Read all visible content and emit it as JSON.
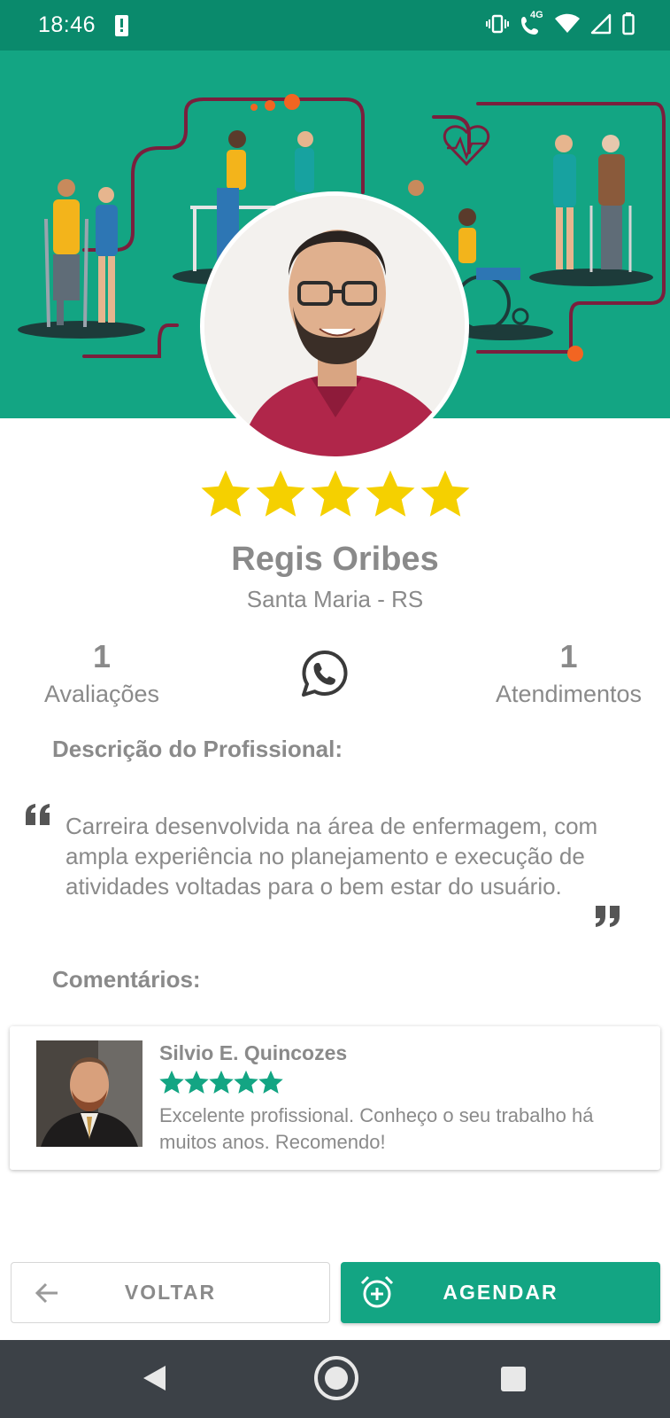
{
  "status_bar": {
    "time": "18:46",
    "network_label": "4G",
    "background": "#0a8a6c"
  },
  "profile": {
    "name": "Regis Oribes",
    "location": "Santa Maria - RS",
    "rating": 5,
    "rating_max": 5,
    "star_color": "#f5d000"
  },
  "stats": {
    "reviews": {
      "value": "1",
      "label": "Avaliações"
    },
    "appointments": {
      "value": "1",
      "label": "Atendimentos"
    },
    "whatsapp_icon": "whatsapp-icon"
  },
  "description": {
    "title": "Descrição do Profissional:",
    "text": "Carreira desenvolvida na área de enfermagem, com ampla experiência no planejamento e execução de atividades voltadas para o bem estar do usuário."
  },
  "comments": {
    "title": "Comentários:",
    "items": [
      {
        "author": "Silvio E. Quincozes",
        "rating": 5,
        "text": "Excelente profissional. Conheço o seu trabalho há muitos anos. Recomendo!"
      }
    ],
    "star_color": "#13a583"
  },
  "actions": {
    "back_label": "VOLTAR",
    "schedule_label": "AGENDAR",
    "accent": "#13a583"
  },
  "theme": {
    "primary": "#13a583",
    "text_gray": "#8a8a8a"
  }
}
